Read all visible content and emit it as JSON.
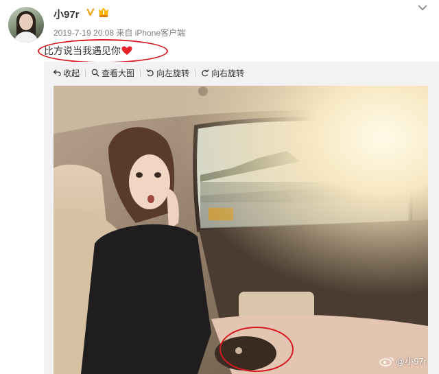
{
  "post": {
    "username": "小97r",
    "timestamp": "2019-7-19 20:08",
    "source": "来自 iPhone客户端",
    "text": "比方说当我遇见你"
  },
  "toolbar": {
    "collapse": "收起",
    "view_large": "查看大图",
    "rotate_left": "向左旋转",
    "rotate_right": "向右旋转"
  },
  "watermark": {
    "handle": "@小97r"
  },
  "icons": {
    "verified": "verified-v-icon",
    "vip": "vip-badge-icon",
    "more": "chevron-down-icon",
    "heart": "heart-icon",
    "collapse": "collapse-arrow-icon",
    "view_large": "magnifier-icon",
    "rotate_left": "rotate-left-icon",
    "rotate_right": "rotate-right-icon"
  },
  "colors": {
    "highlight_circle": "#d7181e",
    "verified": "#f5a623",
    "heart": "#e8232c",
    "toolbar_bg": "#f2f2f5"
  }
}
